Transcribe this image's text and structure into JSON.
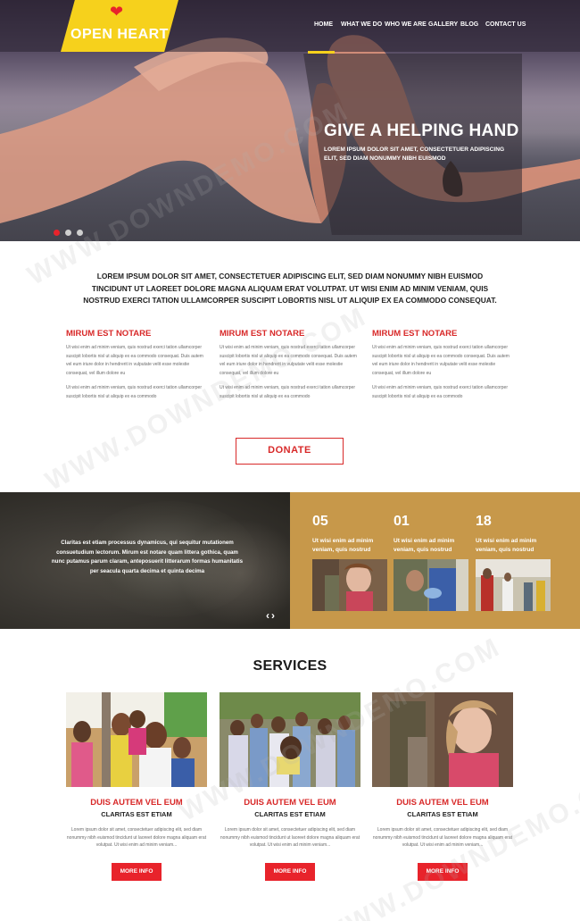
{
  "brand": {
    "logo_text": "OPEN HEART",
    "accent": "#f6d11c",
    "red": "#e8232b"
  },
  "nav": {
    "items": [
      "HOME",
      "WHAT WE DO",
      "WHO WE ARE",
      "GALLERY",
      "BLOG",
      "CONTACT US"
    ],
    "active": "HOME"
  },
  "hero": {
    "title": "GIVE A HELPING HAND",
    "subtitle": "LOREM IPSUM DOLOR SIT AMET, CONSECTETUER ADIPISCING ELIT, SED DIAM NONUMMY NIBH EUISMOD",
    "slides": 3,
    "active_slide": 1
  },
  "intro": {
    "text": "LOREM IPSUM DOLOR SIT AMET, CONSECTETUER ADIPISCING ELIT, SED DIAM NONUMMY NIBH EUISMOD TINCIDUNT UT LAOREET DOLORE MAGNA ALIQUAM ERAT VOLUTPAT. UT WISI ENIM AD MINIM VENIAM, QUIS NOSTRUD EXERCI TATION ULLAMCORPER SUSCIPIT LOBORTIS NISL UT ALIQUIP EX EA COMMODO CONSEQUAT."
  },
  "columns": [
    {
      "title": "MIRUM EST NOTARE",
      "para1": "Ut wisi enim ad minim veniam, quis nostrud exerci tation ullamcorper suscipit lobortis nisl ut aliquip ex ea commodo consequat. Duis autem vel eum iriure dolor in hendrerit in vulputate velit esse molestie consequat, vel illum dolore eu",
      "para2": "Ut wisi enim ad minim veniam, quis nostrud exerci tation ullamcorper suscipit lobortis nisl ut aliquip ex ea commodo"
    },
    {
      "title": "MIRUM EST NOTARE",
      "para1": "Ut wisi enim ad minim veniam, quis nostrud exerci tation ullamcorper suscipit lobortis nisl ut aliquip ex ea commodo consequat. Duis autem vel eum iriure dolor in hendrerit in vulputate velit esse molestie consequat, vel illum dolore eu",
      "para2": "Ut wisi enim ad minim veniam, quis nostrud exerci tation ullamcorper suscipit lobortis nisl ut aliquip ex ea commodo"
    },
    {
      "title": "MIRUM EST NOTARE",
      "para1": "Ut wisi enim ad minim veniam, quis nostrud exerci tation ullamcorper suscipit lobortis nisl ut aliquip ex ea commodo consequat. Duis autem vel eum iriure dolor in hendrerit in vulputate velit esse molestie consequat, vel illum dolore eu",
      "para2": "Ut wisi enim ad minim veniam, quis nostrud exerci tation ullamcorper suscipit lobortis nisl ut aliquip ex ea commodo"
    }
  ],
  "donate_label": "DONATE",
  "band": {
    "quote": "Claritas est etiam processus dynamicus, qui sequitur mutationem consuetudium lectorum. Mirum est notare quam littera gothica, quam nunc putamus parum claram, anteposuerit litterarum formas humanitatis per seacula quarta decima et quinta decima",
    "arrows": "‹›",
    "stats": [
      {
        "num": "05",
        "text": "Ut wisi enim ad minim veniam, quis nostrud"
      },
      {
        "num": "01",
        "text": "Ut wisi enim ad minim veniam, quis nostrud"
      },
      {
        "num": "18",
        "text": "Ut wisi enim ad minim veniam, quis nostrud"
      }
    ]
  },
  "services": {
    "title": "SERVICES",
    "items": [
      {
        "title": "DUIS AUTEM VEL EUM",
        "subtitle": "CLARITAS EST ETIAM",
        "text": "Lorem ipsum dolor sit amet, consectetuer adipiscing elit, sed diam nonummy nibh euismod tincidunt ut laoreet dolore magna aliquam erat volutpat. Ut wisi enim ad minim veniam...",
        "button": "MORE INFO"
      },
      {
        "title": "DUIS AUTEM VEL EUM",
        "subtitle": "CLARITAS EST ETIAM",
        "text": "Lorem ipsum dolor sit amet, consectetuer adipiscing elit, sed diam nonummy nibh euismod tincidunt ut laoreet dolore magna aliquam erat volutpat. Ut wisi enim ad minim veniam...",
        "button": "MORE INFO"
      },
      {
        "title": "DUIS AUTEM VEL EUM",
        "subtitle": "CLARITAS EST ETIAM",
        "text": "Lorem ipsum dolor sit amet, consectetuer adipiscing elit, sed diam nonummy nibh euismod tincidunt ut laoreet dolore magna aliquam erat volutpat. Ut wisi enim ad minim veniam...",
        "button": "MORE INFO"
      }
    ]
  },
  "watermark": "WWW.DOWNDEMO.COM"
}
